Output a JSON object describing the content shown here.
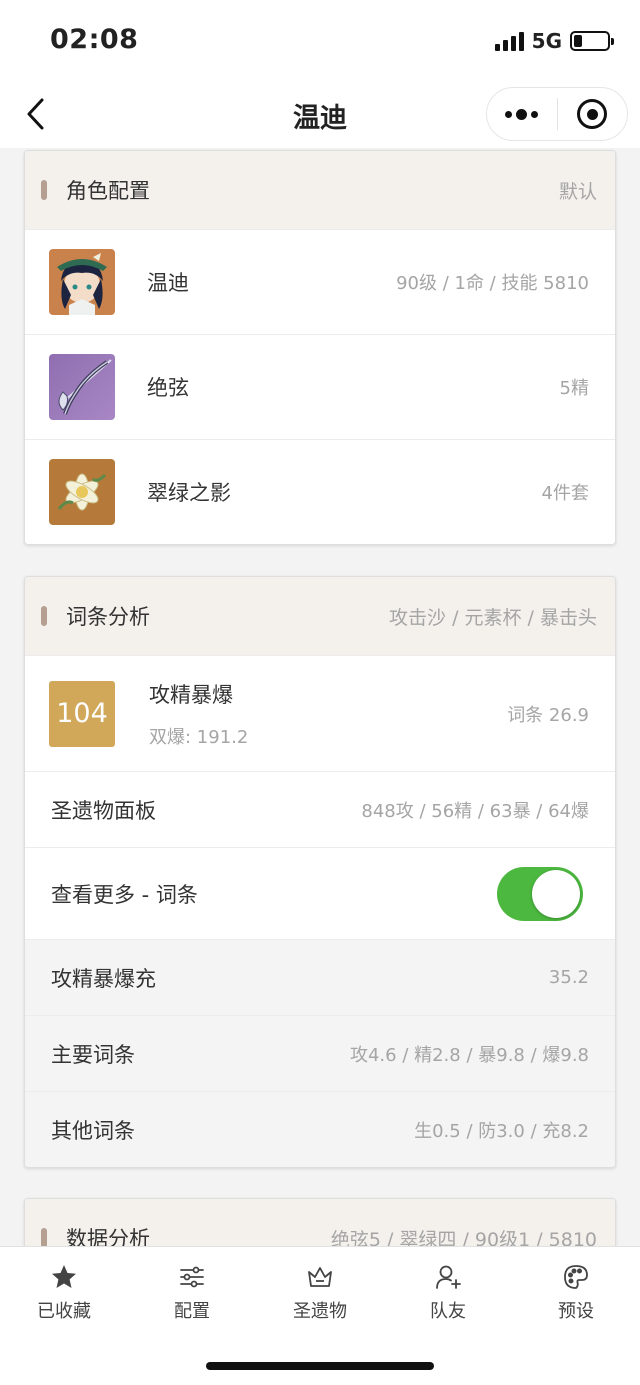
{
  "status": {
    "time": "02:08",
    "network": "5G",
    "battery_percent": 25
  },
  "nav": {
    "title": "温迪"
  },
  "role_card": {
    "title": "角色配置",
    "extra": "默认",
    "items": [
      {
        "name": "温迪",
        "value": "90级 / 1命 / 技能 5810",
        "icon": "character-avatar"
      },
      {
        "name": "绝弦",
        "value": "5精",
        "icon": "bow-weapon"
      },
      {
        "name": "翠绿之影",
        "value": "4件套",
        "icon": "artifact-flower"
      }
    ]
  },
  "stat_card": {
    "title": "词条分析",
    "extra": "攻击沙 / 元素杯 / 暴击头",
    "score": {
      "value": "104",
      "title": "攻精暴爆",
      "sub": "双爆: 191.2",
      "right": "词条 26.9",
      "color": "#d1a85a"
    },
    "panel": {
      "label": "圣遗物面板",
      "value": "848攻 / 56精 / 63暴 / 64爆"
    },
    "more": {
      "label": "查看更多 - 词条",
      "enabled": true
    },
    "details": [
      {
        "label": "攻精暴爆充",
        "value": "35.2"
      },
      {
        "label": "主要词条",
        "value": "攻4.6 / 精2.8 / 暴9.8 / 爆9.8"
      },
      {
        "label": "其他词条",
        "value": "生0.5 / 防3.0 / 充8.2"
      }
    ]
  },
  "data_card": {
    "title": "数据分析",
    "extra": "绝弦5 / 翠绿四 / 90级1 / 5810"
  },
  "tabbar": [
    {
      "label": "已收藏",
      "icon": "star-icon"
    },
    {
      "label": "配置",
      "icon": "sliders-icon"
    },
    {
      "label": "圣遗物",
      "icon": "crown-icon"
    },
    {
      "label": "队友",
      "icon": "add-user-icon"
    },
    {
      "label": "预设",
      "icon": "palette-icon"
    }
  ],
  "colors": {
    "accent_green": "#4cb83f",
    "header_bg": "#f4f1ed",
    "header_bar": "#b49f91"
  }
}
